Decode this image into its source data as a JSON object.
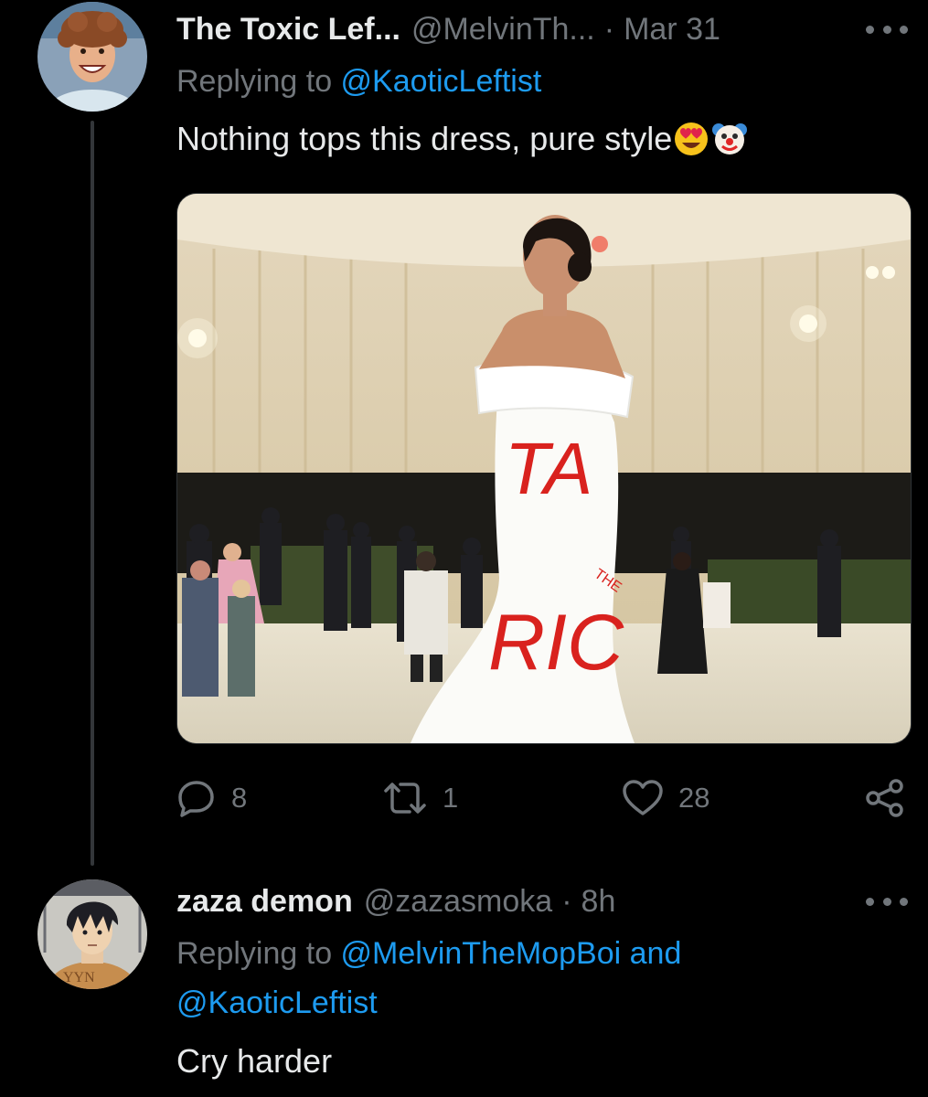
{
  "thread": {
    "tweet": {
      "display_name": "The Toxic Lef...",
      "handle": "@MelvinTh...",
      "separator": "·",
      "time": "Mar 31",
      "replying_prefix": "Replying to ",
      "replying_mention": "@KaoticLeftist",
      "text": "Nothing tops this dress, pure style",
      "emojis": [
        "heart-eyes-emoji",
        "clown-emoji"
      ],
      "media": {
        "dress_text_top": "TA",
        "dress_text_small": "THE",
        "dress_text_bottom": "RIC"
      },
      "actions": {
        "replies": "8",
        "retweets": "1",
        "likes": "28"
      }
    },
    "reply": {
      "display_name": "zaza demon",
      "handle": "@zazasmoka",
      "separator": "·",
      "time": "8h",
      "replying_prefix": "Replying to ",
      "replying_mention_1": "@MelvinTheMopBoi",
      "replying_joiner": " and",
      "replying_mention_2": "@KaoticLeftist",
      "text": "Cry harder",
      "avatar_text": "YYN"
    }
  },
  "colors": {
    "background": "#000000",
    "text_primary": "#e7e9ea",
    "text_secondary": "#71767b",
    "link": "#1d9bf0",
    "dress_text": "#d9221e"
  },
  "icons": [
    "more-icon",
    "reply-icon",
    "retweet-icon",
    "like-icon",
    "share-icon"
  ]
}
